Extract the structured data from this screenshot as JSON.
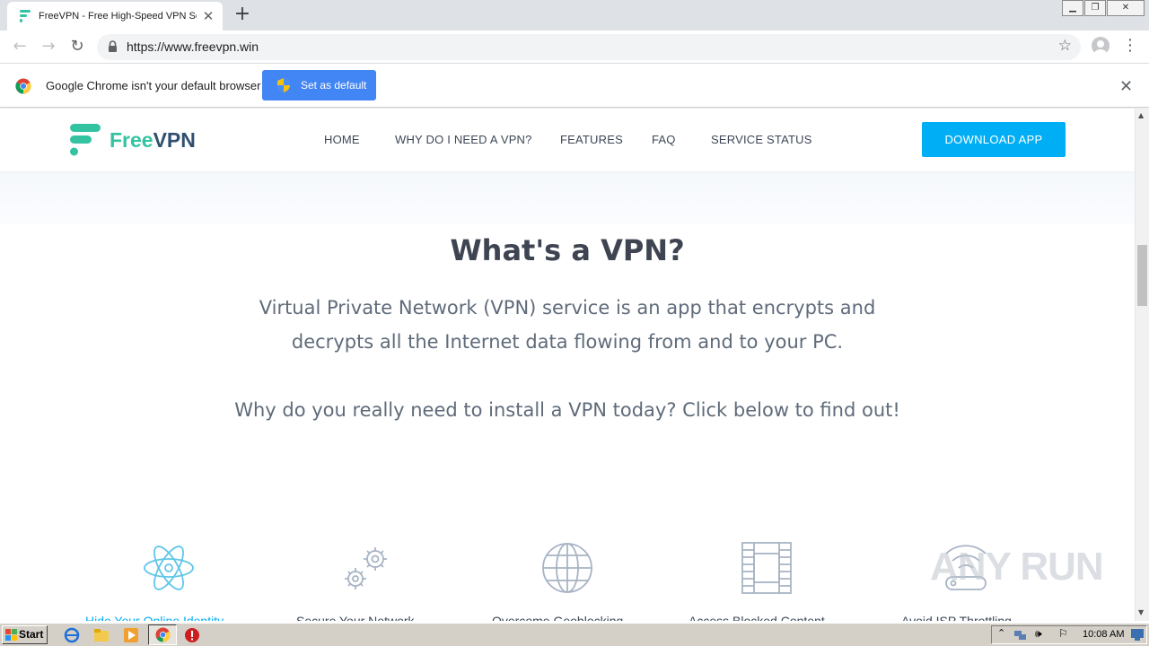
{
  "browser": {
    "tab_title": "FreeVPN - Free High-Speed VPN Ser",
    "new_tab": "+",
    "url": "https://www.freevpn.win",
    "infobar_text": "Google Chrome isn't your default browser",
    "set_default_label": "Set as default"
  },
  "site": {
    "brand_free": "Free",
    "brand_vpn": "VPN",
    "nav": [
      "HOME",
      "WHY DO I NEED A VPN?",
      "FEATURES",
      "FAQ",
      "SERVICE STATUS"
    ],
    "download_label": "DOWNLOAD APP",
    "headline": "What's a VPN?",
    "para_line1": "Virtual Private Network (VPN) service is an app that encrypts and",
    "para_line2": "decrypts all the Internet data flowing from and to your PC.",
    "para_line3": "Why do you really need to install a VPN today? Click below to find out!",
    "features": [
      {
        "icon": "atom-icon",
        "label": "Hide Your Online Identity"
      },
      {
        "icon": "gears-icon",
        "label": "Secure Your Network"
      },
      {
        "icon": "globe-icon",
        "label": "Overcome Geoblocking"
      },
      {
        "icon": "film-icon",
        "label": "Access Blocked Content"
      },
      {
        "icon": "wifi-icon",
        "label": "Avoid ISP Throttling"
      }
    ],
    "accent_color": "#00aef5",
    "brand_green": "#34c3a1"
  },
  "watermark": "ANY RUN",
  "taskbar": {
    "start_label": "Start",
    "clock": "10:08 AM"
  }
}
